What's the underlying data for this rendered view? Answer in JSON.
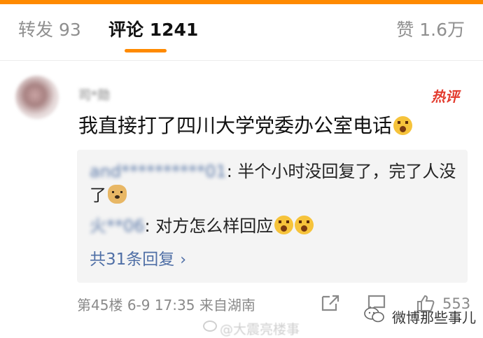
{
  "tabs": {
    "repost": "转发 93",
    "comments": "评论 1241",
    "likes": "赞 1.6万"
  },
  "comment": {
    "username": "司*勋",
    "hot_badge": "热评",
    "text": "我直接打了四川大学党委办公室电话",
    "replies": [
      {
        "name": "and**********01",
        "text": ": 半个小时没回复了，完了人没了"
      },
      {
        "name": "火**06",
        "text": ": 对方怎么样回应"
      }
    ],
    "more_replies": "共31条回复",
    "floor": "第45楼",
    "time": "6-9 17:35",
    "location": "来自湖南",
    "like_count": "553"
  },
  "watermark": "@大震亮楼事",
  "brand": "微博那些事儿",
  "colors": {
    "accent": "#ff8a00",
    "link": "#4f6fa6",
    "hot": "#e33b2e"
  }
}
